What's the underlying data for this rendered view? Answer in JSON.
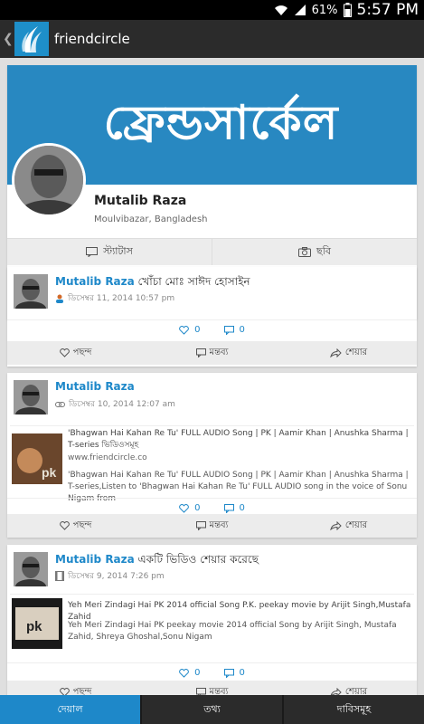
{
  "status_bar": {
    "battery": "61%",
    "time": "5:57 PM",
    "wifi_icon": "wifi-icon",
    "signal_icon": "signal-icon",
    "battery_icon": "battery-icon"
  },
  "app_bar": {
    "title": "friendcircle",
    "back_icon": "back-chevron-icon",
    "logo_icon": "friendcircle-logo-icon"
  },
  "profile": {
    "cover_text": "ফ্রেন্ডসার্কেল",
    "name": "Mutalib Raza",
    "location": "Moulvibazar, Bangladesh",
    "tabs": [
      {
        "label": "স্ট্যাটাস",
        "icon": "status-icon"
      },
      {
        "label": "ছবি",
        "icon": "camera-icon"
      }
    ]
  },
  "posts": [
    {
      "author": "Mutalib Raza",
      "action": " খোঁচা মোঃ সাঈদ হোসাইন",
      "timestamp": "ডিসেম্বর 11, 2014 10:57 pm",
      "likes": "0",
      "comments": "0",
      "actions": [
        "পছন্দ",
        "মন্তব্য",
        "শেয়ার"
      ]
    },
    {
      "author": "Mutalib Raza",
      "action": "",
      "timestamp": "ডিসেম্বর 10, 2014 12:07 am",
      "link": {
        "title": "'Bhagwan Hai Kahan Re Tu' FULL AUDIO Song | PK | Aamir Khan | Anushka Sharma | T-series ভিডিওসমূহ",
        "url": "www.friendcircle.co",
        "description": "'Bhagwan Hai Kahan Re Tu' FULL AUDIO Song | PK | Aamir Khan | Anushka Sharma | T-series,Listen to 'Bhagwan Hai Kahan Re Tu' FULL AUDIO song in the voice of Sonu Nigam from",
        "thumb_text": "BHAGWAN HAI KAHAN RE TU pk"
      },
      "likes": "0",
      "comments": "0",
      "actions": [
        "পছন্দ",
        "মন্তব্য",
        "শেয়ার"
      ]
    },
    {
      "author": "Mutalib Raza",
      "action": " একটি ভিডিও শেয়ার করেছে",
      "timestamp": "ডিসেম্বর 9, 2014 7:26 pm",
      "link": {
        "title": "Yeh Meri Zindagi Hai PK 2014 official Song P.K. peekay movie by Arijit Singh,Mustafa Zahid",
        "description": "Yeh Meri Zindagi Hai PK peekay movie 2014 official Song by Arijit Singh, Mustafa Zahid, Shreya Ghoshal,Sonu Nigam",
        "thumb_text": "pk"
      },
      "likes": "0",
      "comments": "0",
      "actions": [
        "পছন্দ",
        "মন্তব্য",
        "শেয়ার"
      ]
    }
  ],
  "bottom_nav": [
    {
      "label": "দেয়াল",
      "active": true
    },
    {
      "label": "তথ্য",
      "active": false
    },
    {
      "label": "দাবিসমূহ",
      "active": false
    }
  ],
  "colors": {
    "accent": "#1e88c9",
    "cover": "#2888c1",
    "bar": "#2b2b2b"
  }
}
